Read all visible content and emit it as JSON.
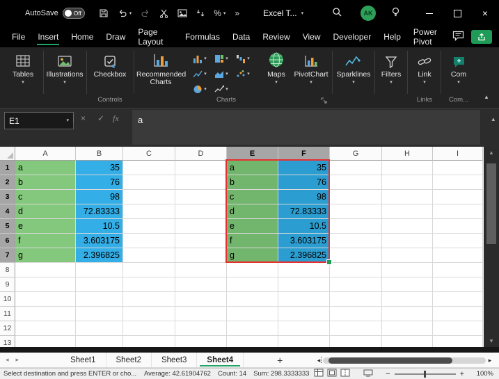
{
  "colors": {
    "green_fill": "#84c87d",
    "green_fill_selected": "#72b56c",
    "blue_fill": "#33aee6",
    "blue_fill_selected": "#2c9dd0",
    "selection_border": "#e8312f",
    "accent_green": "#21a366"
  },
  "titlebar": {
    "autosave_label": "AutoSave",
    "autosave_state": "Off",
    "doc_title": "Excel T...",
    "avatar_initials": "AK"
  },
  "menu": {
    "active": "Insert",
    "tabs": [
      "File",
      "Insert",
      "Home",
      "Draw",
      "Page Layout",
      "Formulas",
      "Data",
      "Review",
      "View",
      "Developer",
      "Help",
      "Power Pivot"
    ]
  },
  "ribbon": {
    "tables": "Tables",
    "illustrations": "Illustrations",
    "checkbox": "Checkbox",
    "recommended_charts": "Recommended Charts",
    "maps": "Maps",
    "pivotchart": "PivotChart",
    "sparklines": "Sparklines",
    "filters": "Filters",
    "link": "Link",
    "comments": "Com",
    "groups": {
      "controls": "Controls",
      "charts": "Charts",
      "links": "Links",
      "comments": "Com..."
    }
  },
  "formula_bar": {
    "name_box": "E1",
    "content": "a",
    "fx_label": "fx"
  },
  "grid": {
    "columns": [
      "A",
      "B",
      "C",
      "D",
      "E",
      "F",
      "G",
      "H",
      "I"
    ],
    "selected_columns": [
      "E",
      "F"
    ],
    "selected_rows": [
      1,
      2,
      3,
      4,
      5,
      6,
      7
    ],
    "row_count": 13,
    "rows": [
      {
        "label": "a",
        "value": "35"
      },
      {
        "label": "b",
        "value": "76"
      },
      {
        "label": "c",
        "value": "98"
      },
      {
        "label": "d",
        "value": "72.83333"
      },
      {
        "label": "e",
        "value": "10.5"
      },
      {
        "label": "f",
        "value": "3.603175"
      },
      {
        "label": "g",
        "value": "2.396825"
      }
    ]
  },
  "sheet_tabs": {
    "active": "Sheet4",
    "tabs": [
      "Sheet1",
      "Sheet2",
      "Sheet3",
      "Sheet4"
    ]
  },
  "status_bar": {
    "message": "Select destination and press ENTER or cho...",
    "average": "Average: 42.61904762",
    "count": "Count: 14",
    "sum": "Sum: 298.3333333",
    "zoom": "100%"
  }
}
